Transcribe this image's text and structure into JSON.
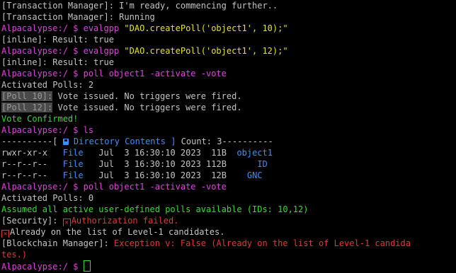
{
  "colors": {
    "background": "#000000",
    "text": "#c4c4c4",
    "prompt": "#dd44dd",
    "command_arg": "#e6e600",
    "success": "#33dd33",
    "info": "#3d8fff",
    "error": "#ee3333"
  },
  "l01": "[Transaction Manager]: I'm ready, commencing further..",
  "l02": "[Transaction Manager]: Running",
  "l03": {
    "prompt": "Alpacalypse:/ $ ",
    "cmd": "evalgpp ",
    "arg": "\"DAO.createPoll('object1', 10);\""
  },
  "l04": "[inline]: Result: true",
  "l05": {
    "prompt": "Alpacalypse:/ $ ",
    "cmd": "evalgpp ",
    "arg": "\"DAO.createPoll('object1', 12);\""
  },
  "l06": "[inline]: Result: true",
  "l07": {
    "prompt": "Alpacalypse:/ $ ",
    "cmd": "poll object1 -activate -vote"
  },
  "l08": "Activated Polls: 2",
  "l09": {
    "tag": "[Poll 10]:",
    "text": " Vote issued. No triggers were fired."
  },
  "l10": {
    "tag": "[Poll 12]:",
    "text": " Vote issued. No triggers were fired."
  },
  "l11": "Vote Confirmed!",
  "l12": {
    "prompt": "Alpacalypse:/ $ ",
    "cmd": "ls"
  },
  "l13": {
    "dash_left": "----------[ ",
    "folder_icon": "folder-icon",
    "title": " Directory Contents ] ",
    "count_label": "Count: 3",
    "dash_right": "----------"
  },
  "listing": [
    {
      "perms": "rwxr-xr-x",
      "type": "File",
      "date": "Jul  3 16:30:10 2023",
      "size": "11B",
      "name": "object1"
    },
    {
      "perms": "r--r--r--",
      "type": "File",
      "date": "Jul  3 16:30:10 2023",
      "size": "112B",
      "name": "ID"
    },
    {
      "perms": "r--r--r--",
      "type": "File",
      "date": "Jul  3 16:30:10 2023",
      "size": "12B",
      "name": "GNC"
    }
  ],
  "l17": {
    "prompt": "Alpacalypse:/ $ ",
    "cmd": "poll object1 -activate -vote"
  },
  "l18": "Activated Polls: 0",
  "l19": "Assumed all active user-defined polls available (IDs: 10,12)",
  "l20": {
    "tag": "[Security]: ",
    "icon": "x-icon",
    "text": "Authorization failed."
  },
  "l21": {
    "icon": "x-icon",
    "text": "Already on the list of Level-1 candidates."
  },
  "l22": {
    "tag": "[Blockchain Manager]: ",
    "text": "Exception v: False (Already on the list of Level-1 candida"
  },
  "l23": "tes.)",
  "l24": {
    "prompt": "Alpacalypse:/ $ ",
    "input": ""
  }
}
